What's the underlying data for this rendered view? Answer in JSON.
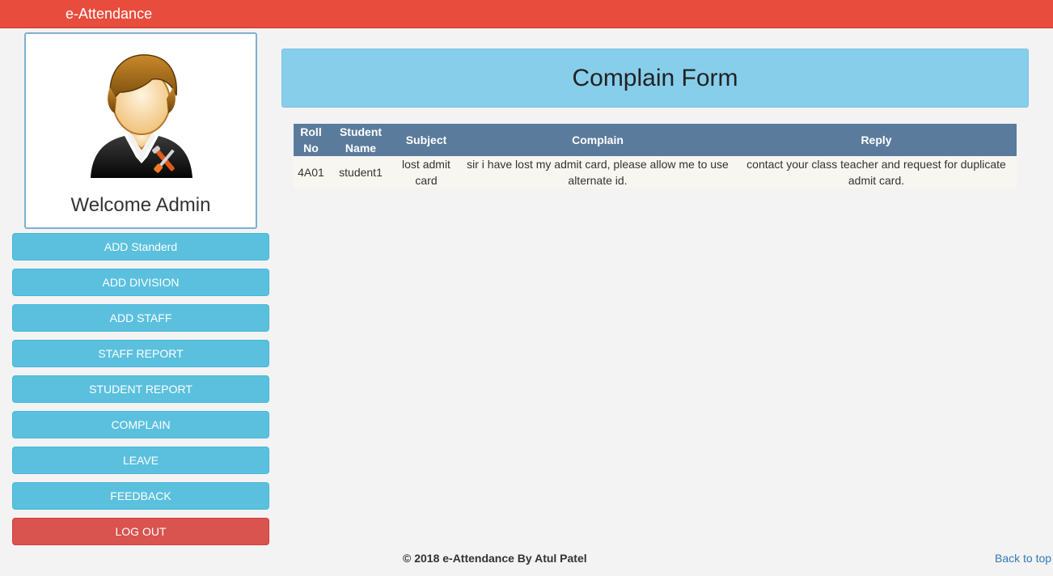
{
  "brand": "e-Attendance",
  "profile": {
    "welcome": "Welcome Admin",
    "avatar_icon": "admin-user-icon"
  },
  "nav": {
    "add_standard": "ADD Standerd",
    "add_division": "ADD DIVISION",
    "add_staff": "ADD STAFF",
    "staff_report": "STAFF REPORT",
    "student_report": "STUDENT REPORT",
    "complain": "COMPLAIN",
    "leave": "LEAVE",
    "feedback": "FEEDBACK",
    "logout": "LOG OUT"
  },
  "page_title": "Complain Form",
  "table": {
    "headers": [
      "Roll No",
      "Student Name",
      "Subject",
      "Complain",
      "Reply"
    ],
    "rows": [
      [
        "4A01",
        "student1",
        "lost admit card",
        "sir i have lost my admit card, please allow me to use alternate id.",
        "contact your class teacher and request for duplicate admit card."
      ]
    ]
  },
  "footer": {
    "copyright": "© 2018 e-Attendance By Atul Patel",
    "back_to_top": "Back to top"
  },
  "colors": {
    "topbar": "#e84c3d",
    "nav_button": "#5bc0de",
    "logout_button": "#d9534f",
    "title_panel": "#87ceeb",
    "table_header": "#5a7b9c"
  }
}
